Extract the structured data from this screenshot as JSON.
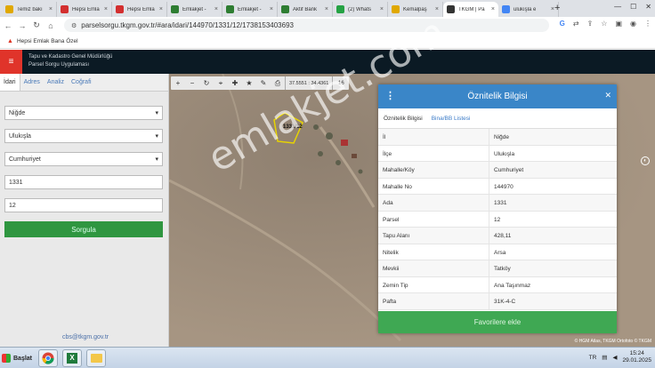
{
  "browser": {
    "tabs": [
      {
        "title": "Temiz bakı",
        "icon": "s-icon",
        "color": "#e0a800"
      },
      {
        "title": "Hepsi Emla",
        "icon": "hepsiemlak-icon",
        "color": "#d32f2f"
      },
      {
        "title": "Hepsi Emla",
        "icon": "hepsiemlak-icon",
        "color": "#d32f2f"
      },
      {
        "title": "Emlakjet -",
        "icon": "emlakjet-icon",
        "color": "#2e7d32"
      },
      {
        "title": "Emlakjet -",
        "icon": "emlakjet-icon",
        "color": "#2e7d32"
      },
      {
        "title": "Aktif Bank",
        "icon": "emlakjet-icon",
        "color": "#2e7d32"
      },
      {
        "title": "(2) Whats",
        "icon": "whatsapp-icon",
        "color": "#25a244"
      },
      {
        "title": "Kemalpaş",
        "icon": "s-icon",
        "color": "#e0a800"
      },
      {
        "title": "TKGM | Pa",
        "icon": "location-icon",
        "color": "#333333"
      },
      {
        "title": "ulukışla e",
        "icon": "google-icon",
        "color": "#4285f4"
      }
    ],
    "url": "parselsorgu.tkgm.gov.tr/#ara/idari/144970/1331/12/1738153403693",
    "bookmark": "Hepsi Emlak Bana Özel"
  },
  "app": {
    "org_line1": "Tapu ve Kadastro Genel Müdürlüğü",
    "org_line2": "Parsel Sorgu Uygulaması"
  },
  "sidebar": {
    "tabs": [
      "İdari",
      "Adres",
      "Analiz",
      "Coğrafi"
    ],
    "il": "Niğde",
    "ilce": "Ulukışla",
    "mahalle": "Cumhuriyet",
    "ada": "1331",
    "parsel": "12",
    "sorgula_label": "Sorgula",
    "email": "cbs@tkgm.gov.tr"
  },
  "map": {
    "coords": "37.5551 : 34.4361",
    "zoom": "16",
    "parcel_label": "1331/12",
    "watermark": "emlakjet.com",
    "credit": "© HGM Atlas, TKGM Ortofoto © TKGM"
  },
  "panel": {
    "title": "Öznitelik Bilgisi",
    "tabs": [
      "Öznitelik Bilgisi",
      "Bina/BB Listesi"
    ],
    "rows": [
      {
        "key": "İl",
        "value": "Niğde"
      },
      {
        "key": "İlçe",
        "value": "Ulukışla"
      },
      {
        "key": "Mahalle/Köy",
        "value": "Cumhuriyet"
      },
      {
        "key": "Mahalle No",
        "value": "144970"
      },
      {
        "key": "Ada",
        "value": "1331"
      },
      {
        "key": "Parsel",
        "value": "12"
      },
      {
        "key": "Tapu Alanı",
        "value": "428,11"
      },
      {
        "key": "Nitelik",
        "value": "Arsa"
      },
      {
        "key": "Mevkii",
        "value": "Tatköy"
      },
      {
        "key": "Zemin Tip",
        "value": "Ana Taşınmaz"
      },
      {
        "key": "Pafta",
        "value": "31K-4-C"
      }
    ],
    "fav_label": "Favorilere ekle"
  },
  "taskbar": {
    "start": "Başlat",
    "lang": "TR",
    "time": "15:24",
    "date": "29.01.2025"
  }
}
